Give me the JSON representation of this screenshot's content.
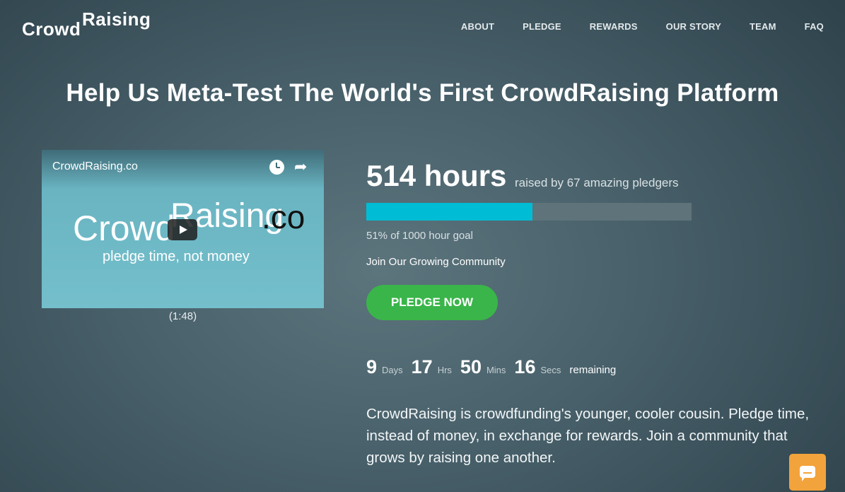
{
  "header": {
    "logo_crowd": "Crowd",
    "logo_raising": "Raising",
    "nav": [
      "ABOUT",
      "PLEDGE",
      "REWARDS",
      "OUR STORY",
      "TEAM",
      "FAQ"
    ]
  },
  "headline": "Help Us Meta-Test The World's First CrowdRaising Platform",
  "video": {
    "title": "CrowdRaising.co",
    "brand_crowd": "Crowd",
    "brand_raising": "Raising",
    "brand_co": ".co",
    "tagline": "pledge time, not money",
    "duration": "(1:48)"
  },
  "stats": {
    "hours": "514 hours",
    "raised_by": "raised by 67 amazing pledgers",
    "progress_percent": 51,
    "goal_text": "51% of 1000 hour goal",
    "community_text": "Join Our Growing Community",
    "pledge_button": "PLEDGE NOW"
  },
  "countdown": {
    "days": "9",
    "days_label": "Days",
    "hrs": "17",
    "hrs_label": "Hrs",
    "mins": "50",
    "mins_label": "Mins",
    "secs": "16",
    "secs_label": "Secs",
    "remaining": "remaining"
  },
  "description": "CrowdRaising is crowdfunding's younger, cooler cousin. Pledge time, instead of money, in exchange for rewards. Join a community that grows by raising one another.",
  "colors": {
    "accent": "#00bcd4",
    "pledge_button": "#3ab54a",
    "chat_button": "#f3a33b"
  },
  "icons": {
    "watch_later": "clock-icon",
    "share": "share-icon",
    "play": "play-icon",
    "chat": "chat-icon"
  }
}
